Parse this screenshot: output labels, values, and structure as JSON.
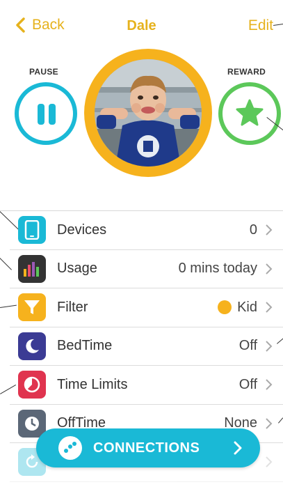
{
  "nav": {
    "back_label": "Back",
    "title": "Dale",
    "edit_label": "Edit"
  },
  "actions": {
    "pause_label": "PAUSE",
    "reward_label": "REWARD"
  },
  "colors": {
    "accent_gold": "#e6b21d",
    "pause_blue": "#1ab9d6",
    "reward_green": "#5cc85a"
  },
  "settings": [
    {
      "label": "Devices",
      "value": "0",
      "icon": "tablet-icon"
    },
    {
      "label": "Usage",
      "value": "0 mins today",
      "icon": "bar-chart-icon"
    },
    {
      "label": "Filter",
      "value": "Kid",
      "icon": "filter-icon"
    },
    {
      "label": "BedTime",
      "value": "Off",
      "icon": "moon-icon"
    },
    {
      "label": "Time Limits",
      "value": "Off",
      "icon": "timer-icon"
    },
    {
      "label": "OffTime",
      "value": "None",
      "icon": "clock-icon"
    }
  ],
  "connections_button": {
    "label": "CONNECTIONS"
  }
}
